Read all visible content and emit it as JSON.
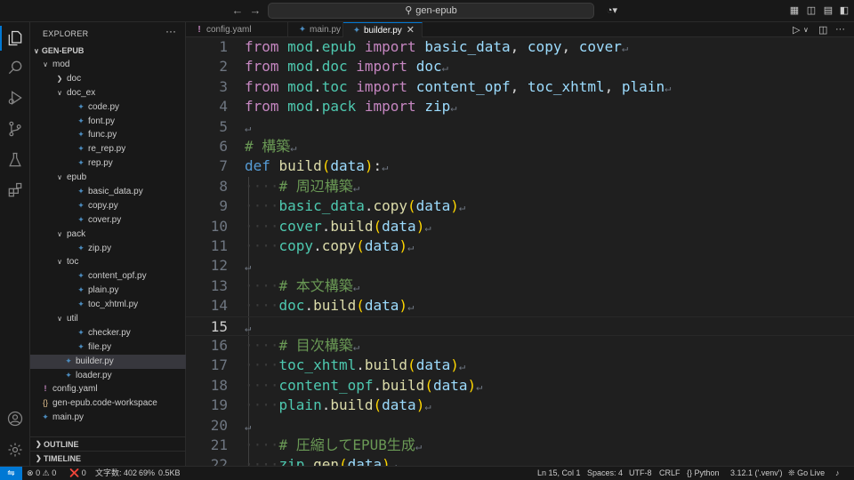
{
  "titlebar": {
    "search_text": "gen-epub",
    "back_icon": "arrow-left-icon",
    "forward_icon": "arrow-right-icon"
  },
  "sidebar": {
    "title": "EXPLORER",
    "root": "GEN-EPUB",
    "tree": [
      {
        "label": "mod",
        "type": "folder",
        "depth": 0,
        "open": true
      },
      {
        "label": "doc",
        "type": "folder",
        "depth": 1,
        "open": false
      },
      {
        "label": "doc_ex",
        "type": "folder",
        "depth": 1,
        "open": true
      },
      {
        "label": "code.py",
        "type": "py",
        "depth": 2
      },
      {
        "label": "font.py",
        "type": "py",
        "depth": 2
      },
      {
        "label": "func.py",
        "type": "py",
        "depth": 2
      },
      {
        "label": "re_rep.py",
        "type": "py",
        "depth": 2
      },
      {
        "label": "rep.py",
        "type": "py",
        "depth": 2
      },
      {
        "label": "epub",
        "type": "folder",
        "depth": 1,
        "open": true
      },
      {
        "label": "basic_data.py",
        "type": "py",
        "depth": 2
      },
      {
        "label": "copy.py",
        "type": "py",
        "depth": 2
      },
      {
        "label": "cover.py",
        "type": "py",
        "depth": 2
      },
      {
        "label": "pack",
        "type": "folder",
        "depth": 1,
        "open": true
      },
      {
        "label": "zip.py",
        "type": "py",
        "depth": 2
      },
      {
        "label": "toc",
        "type": "folder",
        "depth": 1,
        "open": true
      },
      {
        "label": "content_opf.py",
        "type": "py",
        "depth": 2
      },
      {
        "label": "plain.py",
        "type": "py",
        "depth": 2
      },
      {
        "label": "toc_xhtml.py",
        "type": "py",
        "depth": 2
      },
      {
        "label": "util",
        "type": "folder",
        "depth": 1,
        "open": true
      },
      {
        "label": "checker.py",
        "type": "py",
        "depth": 2
      },
      {
        "label": "file.py",
        "type": "py",
        "depth": 2
      },
      {
        "label": "builder.py",
        "type": "py",
        "depth": 1,
        "selected": true
      },
      {
        "label": "loader.py",
        "type": "py",
        "depth": 1
      },
      {
        "label": "config.yaml",
        "type": "yaml",
        "depth": 0
      },
      {
        "label": "gen-epub.code-workspace",
        "type": "workspace",
        "depth": 0
      },
      {
        "label": "main.py",
        "type": "py",
        "depth": 0
      }
    ],
    "outline_label": "OUTLINE",
    "timeline_label": "TIMELINE"
  },
  "tabs": [
    {
      "label": "config.yaml",
      "icon": "!",
      "active": false
    },
    {
      "label": "main.py",
      "icon": "py",
      "active": false
    },
    {
      "label": "builder.py",
      "icon": "py",
      "active": true
    }
  ],
  "editor": {
    "current_line": 15,
    "lines": [
      {
        "n": "1",
        "tokens": [
          [
            "kw",
            "from"
          ],
          [
            "plain",
            " "
          ],
          [
            "mod",
            "mod"
          ],
          [
            "plain",
            "."
          ],
          [
            "mod",
            "epub"
          ],
          [
            "plain",
            " "
          ],
          [
            "kw",
            "import"
          ],
          [
            "plain",
            " "
          ],
          [
            "var",
            "basic_data"
          ],
          [
            "plain",
            ", "
          ],
          [
            "var",
            "copy"
          ],
          [
            "plain",
            ", "
          ],
          [
            "var",
            "cover"
          ]
        ]
      },
      {
        "n": "2",
        "tokens": [
          [
            "kw",
            "from"
          ],
          [
            "plain",
            " "
          ],
          [
            "mod",
            "mod"
          ],
          [
            "plain",
            "."
          ],
          [
            "mod",
            "doc"
          ],
          [
            "plain",
            " "
          ],
          [
            "kw",
            "import"
          ],
          [
            "plain",
            " "
          ],
          [
            "var",
            "doc"
          ]
        ]
      },
      {
        "n": "3",
        "tokens": [
          [
            "kw",
            "from"
          ],
          [
            "plain",
            " "
          ],
          [
            "mod",
            "mod"
          ],
          [
            "plain",
            "."
          ],
          [
            "mod",
            "toc"
          ],
          [
            "plain",
            " "
          ],
          [
            "kw",
            "import"
          ],
          [
            "plain",
            " "
          ],
          [
            "var",
            "content_opf"
          ],
          [
            "plain",
            ", "
          ],
          [
            "var",
            "toc_xhtml"
          ],
          [
            "plain",
            ", "
          ],
          [
            "var",
            "plain"
          ]
        ]
      },
      {
        "n": "4",
        "tokens": [
          [
            "kw",
            "from"
          ],
          [
            "plain",
            " "
          ],
          [
            "mod",
            "mod"
          ],
          [
            "plain",
            "."
          ],
          [
            "mod",
            "pack"
          ],
          [
            "plain",
            " "
          ],
          [
            "kw",
            "import"
          ],
          [
            "plain",
            " "
          ],
          [
            "var",
            "zip"
          ]
        ]
      },
      {
        "n": "5",
        "tokens": []
      },
      {
        "n": "6",
        "tokens": [
          [
            "cmt",
            "# 構築"
          ]
        ]
      },
      {
        "n": "7",
        "tokens": [
          [
            "kw2",
            "def"
          ],
          [
            "plain",
            " "
          ],
          [
            "fn",
            "build"
          ],
          [
            "paren1",
            "("
          ],
          [
            "var",
            "data"
          ],
          [
            "paren1",
            ")"
          ],
          [
            "plain",
            ":"
          ]
        ]
      },
      {
        "n": "8",
        "tokens": [
          [
            "ws",
            "····"
          ],
          [
            "cmt",
            "# 周辺構築"
          ]
        ]
      },
      {
        "n": "9",
        "tokens": [
          [
            "ws",
            "····"
          ],
          [
            "mod",
            "basic_data"
          ],
          [
            "plain",
            "."
          ],
          [
            "fn",
            "copy"
          ],
          [
            "paren1",
            "("
          ],
          [
            "var",
            "data"
          ],
          [
            "paren1",
            ")"
          ]
        ]
      },
      {
        "n": "10",
        "tokens": [
          [
            "ws",
            "····"
          ],
          [
            "mod",
            "cover"
          ],
          [
            "plain",
            "."
          ],
          [
            "fn",
            "build"
          ],
          [
            "paren1",
            "("
          ],
          [
            "var",
            "data"
          ],
          [
            "paren1",
            ")"
          ]
        ]
      },
      {
        "n": "11",
        "tokens": [
          [
            "ws",
            "····"
          ],
          [
            "mod",
            "copy"
          ],
          [
            "plain",
            "."
          ],
          [
            "fn",
            "copy"
          ],
          [
            "paren1",
            "("
          ],
          [
            "var",
            "data"
          ],
          [
            "paren1",
            ")"
          ]
        ]
      },
      {
        "n": "12",
        "tokens": []
      },
      {
        "n": "13",
        "tokens": [
          [
            "ws",
            "····"
          ],
          [
            "cmt",
            "# 本文構築"
          ]
        ]
      },
      {
        "n": "14",
        "tokens": [
          [
            "ws",
            "····"
          ],
          [
            "mod",
            "doc"
          ],
          [
            "plain",
            "."
          ],
          [
            "fn",
            "build"
          ],
          [
            "paren1",
            "("
          ],
          [
            "var",
            "data"
          ],
          [
            "paren1",
            ")"
          ]
        ]
      },
      {
        "n": "15",
        "tokens": []
      },
      {
        "n": "16",
        "tokens": [
          [
            "ws",
            "····"
          ],
          [
            "cmt",
            "# 目次構築"
          ]
        ]
      },
      {
        "n": "17",
        "tokens": [
          [
            "ws",
            "····"
          ],
          [
            "mod",
            "toc_xhtml"
          ],
          [
            "plain",
            "."
          ],
          [
            "fn",
            "build"
          ],
          [
            "paren1",
            "("
          ],
          [
            "var",
            "data"
          ],
          [
            "paren1",
            ")"
          ]
        ]
      },
      {
        "n": "18",
        "tokens": [
          [
            "ws",
            "····"
          ],
          [
            "mod",
            "content_opf"
          ],
          [
            "plain",
            "."
          ],
          [
            "fn",
            "build"
          ],
          [
            "paren1",
            "("
          ],
          [
            "var",
            "data"
          ],
          [
            "paren1",
            ")"
          ]
        ]
      },
      {
        "n": "19",
        "tokens": [
          [
            "ws",
            "····"
          ],
          [
            "mod",
            "plain"
          ],
          [
            "plain",
            "."
          ],
          [
            "fn",
            "build"
          ],
          [
            "paren1",
            "("
          ],
          [
            "var",
            "data"
          ],
          [
            "paren1",
            ")"
          ]
        ]
      },
      {
        "n": "20",
        "tokens": []
      },
      {
        "n": "21",
        "tokens": [
          [
            "ws",
            "····"
          ],
          [
            "cmt",
            "# 圧縮してEPUB生成"
          ]
        ]
      },
      {
        "n": "22",
        "tokens": [
          [
            "ws",
            "····"
          ],
          [
            "mod",
            "zip"
          ],
          [
            "plain",
            "."
          ],
          [
            "fn",
            "gen"
          ],
          [
            "paren1",
            "("
          ],
          [
            "var",
            "data"
          ],
          [
            "paren1",
            ")"
          ]
        ]
      }
    ]
  },
  "statusbar": {
    "errors": "0",
    "warnings": "0",
    "ports": "0",
    "char_count": "文字数: 402",
    "zoom": "69%",
    "size": "0.5KB",
    "position": "Ln 15, Col 1",
    "spaces": "Spaces: 4",
    "encoding": "UTF-8",
    "eol": "CRLF",
    "language": "Python",
    "interpreter": "3.12.1 ('.venv')",
    "golive": "Go Live"
  },
  "colors": {
    "accent": "#0078d4",
    "background": "#1f1f1f",
    "sidebar": "#181818"
  }
}
